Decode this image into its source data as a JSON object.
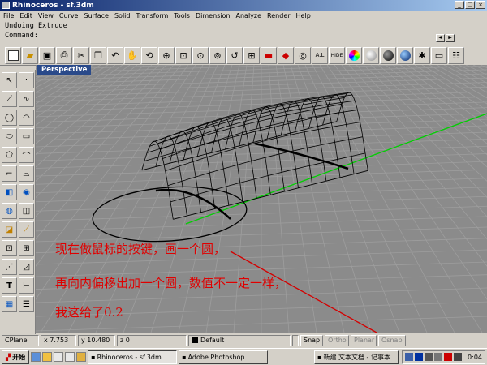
{
  "window": {
    "title": "Rhinoceros - sf.3dm"
  },
  "menu": [
    "File",
    "Edit",
    "View",
    "Curve",
    "Surface",
    "Solid",
    "Transform",
    "Tools",
    "Dimension",
    "Analyze",
    "Render",
    "Help"
  ],
  "command": {
    "history": "Undoing Extrude",
    "prompt": "Command:"
  },
  "viewport": {
    "name": "Perspective"
  },
  "annotation": {
    "line1": "现在做鼠标的按键，画一个圆，",
    "line2": "再向内偏移出加一个圆，数值不一定一样，",
    "line3": "我这给了0.2"
  },
  "statusbar": {
    "cplane": "CPlane",
    "x": "x 7.753",
    "y": "y 10.480",
    "z": "z 0",
    "layer": "Default",
    "snap": "Snap",
    "ortho": "Ortho",
    "planar": "Planar",
    "osnap": "Osnap"
  },
  "taskbar": {
    "start": "开始",
    "items": [
      "Rhinoceros - sf.3dm",
      "Adobe Photoshop"
    ],
    "right_item": "新建 文本文档 - 记事本",
    "clock": "0:04"
  },
  "colors": {
    "viewport_bg": "#8b8b8b",
    "grid_line": "#9d9d9d",
    "x_axis": "#d40000",
    "y_axis": "#00d000",
    "annotation": "#e00000",
    "titlebar": "#0a246a"
  },
  "icons": {
    "toolbar": [
      "new-file-icon",
      "open-folder-icon",
      "save-icon",
      "print-icon",
      "cut-icon",
      "copy-icon",
      "undo-icon",
      "pan-hand-icon",
      "rotate-view-icon",
      "zoom-icon",
      "zoom-window-icon",
      "zoom-extents-icon",
      "zoom-selected-icon",
      "undo-view-icon",
      "four-viewports-icon",
      "car-render-icon",
      "shade-icon",
      "osnap-icon",
      "grid-icon",
      "hide-icon",
      "color-wheel-icon",
      "sphere-gray-icon",
      "sphere-black-icon",
      "render-blue-icon",
      "light-icon",
      "layer-icon",
      "properties-icon"
    ],
    "sidebar": [
      "select-arrow-icon",
      "point-icon",
      "polyline-icon",
      "curve-icon",
      "circle-icon",
      "arc-icon",
      "ellipse-icon",
      "rectangle-icon",
      "polygon-icon",
      "freeform-curve-icon",
      "fillet-icon",
      "offset-icon",
      "surface-icon",
      "box-solid-icon",
      "sphere-solid-icon",
      "boolean-icon",
      "edit-points-icon",
      "trim-icon",
      "move-icon",
      "array-icon",
      "group-icon",
      "scale-icon",
      "text-icon",
      "dimension-icon",
      "layer-tool-icon",
      "analyze-icon"
    ]
  }
}
